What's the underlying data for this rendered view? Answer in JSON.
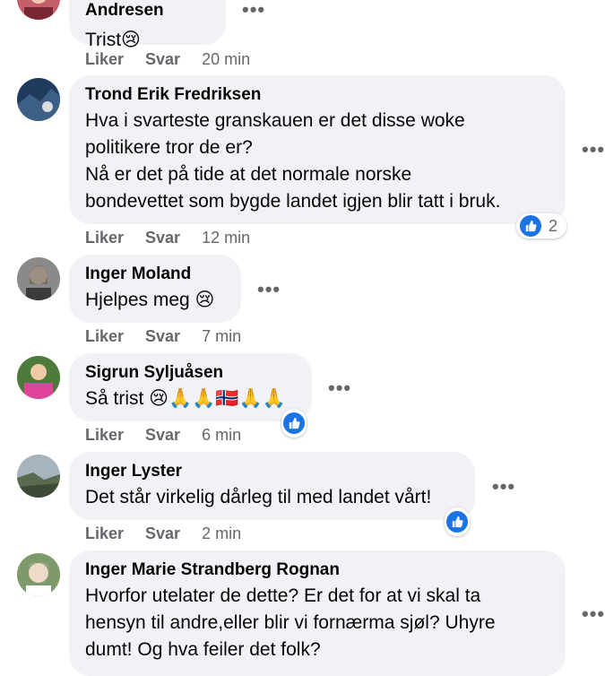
{
  "comments": [
    {
      "name": "Lillian Andresen",
      "text": "Trist😢",
      "like": "Liker",
      "reply": "Svar",
      "time": "20 min",
      "reactions": ""
    },
    {
      "name": "Trond Erik Fredriksen",
      "text": "Hva i svarteste granskauen er det disse woke\npolitikere tror de er?\nNå er det på tide at det normale norske\nbondevettet som bygde landet igjen blir tatt i bruk.",
      "like": "Liker",
      "reply": "Svar",
      "time": "12 min",
      "reactions": "2"
    },
    {
      "name": "Inger Moland",
      "text": "Hjelpes meg 😢",
      "like": "Liker",
      "reply": "Svar",
      "time": "7 min",
      "reactions": ""
    },
    {
      "name": "Sigrun Syljuåsen",
      "text": "Så trist 😢🙏🙏🇳🇴🙏🙏",
      "like": "Liker",
      "reply": "Svar",
      "time": "6 min",
      "reactions": ""
    },
    {
      "name": "Inger Lyster",
      "text": "Det står virkelig dårleg til med landet vårt!",
      "like": "Liker",
      "reply": "Svar",
      "time": "2 min",
      "reactions": ""
    },
    {
      "name": "Inger Marie Strandberg Rognan",
      "text": "Hvorfor utelater de dette? Er det for at vi skal ta\nhensyn til andre,eller blir vi fornærma sjøl? Uhyre\ndumt! Og hva feiler det folk?",
      "like": "Liker",
      "reply": "Svar",
      "time": "",
      "reactions": ""
    }
  ],
  "colors": {
    "bubble": "#f0f2f5",
    "accent": "#1b74e4",
    "meta": "#65676b"
  },
  "icons": {
    "more": "more-options-icon",
    "like": "like-reaction-icon"
  }
}
